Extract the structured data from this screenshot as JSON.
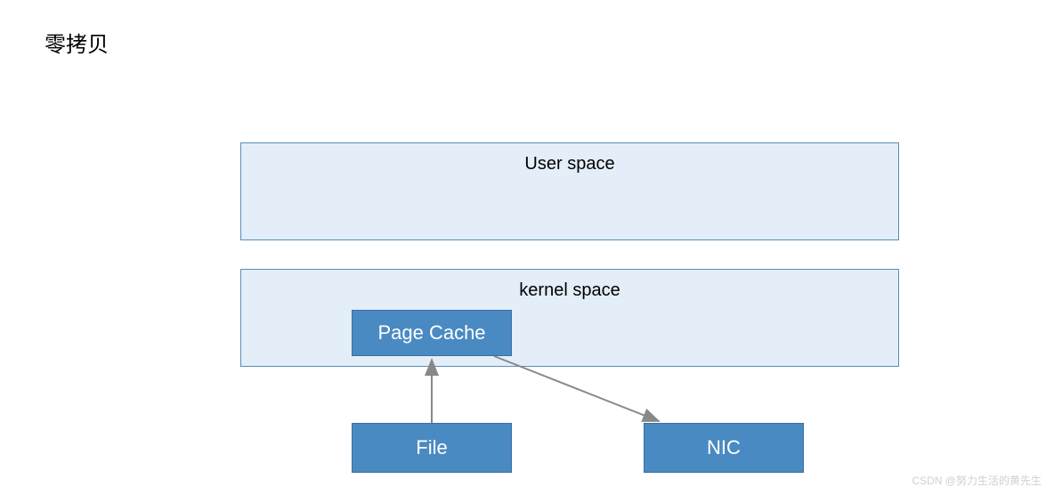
{
  "title": "零拷贝",
  "boxes": {
    "user_space": "User space",
    "kernel_space": "kernel space",
    "page_cache": "Page Cache",
    "file": "File",
    "nic": "NIC"
  },
  "arrows": [
    {
      "from": "File",
      "to": "Page Cache",
      "direction": "up"
    },
    {
      "from": "Page Cache",
      "to": "NIC",
      "direction": "diagonal-down-right"
    }
  ],
  "colors": {
    "light_box_bg": "#e3eef8",
    "light_box_border": "#5a8db8",
    "dark_box_bg": "#4a8ac2",
    "dark_box_border": "#3a6fa0",
    "arrow": "#888888"
  },
  "watermark": "CSDN @努力生活的黄先生"
}
